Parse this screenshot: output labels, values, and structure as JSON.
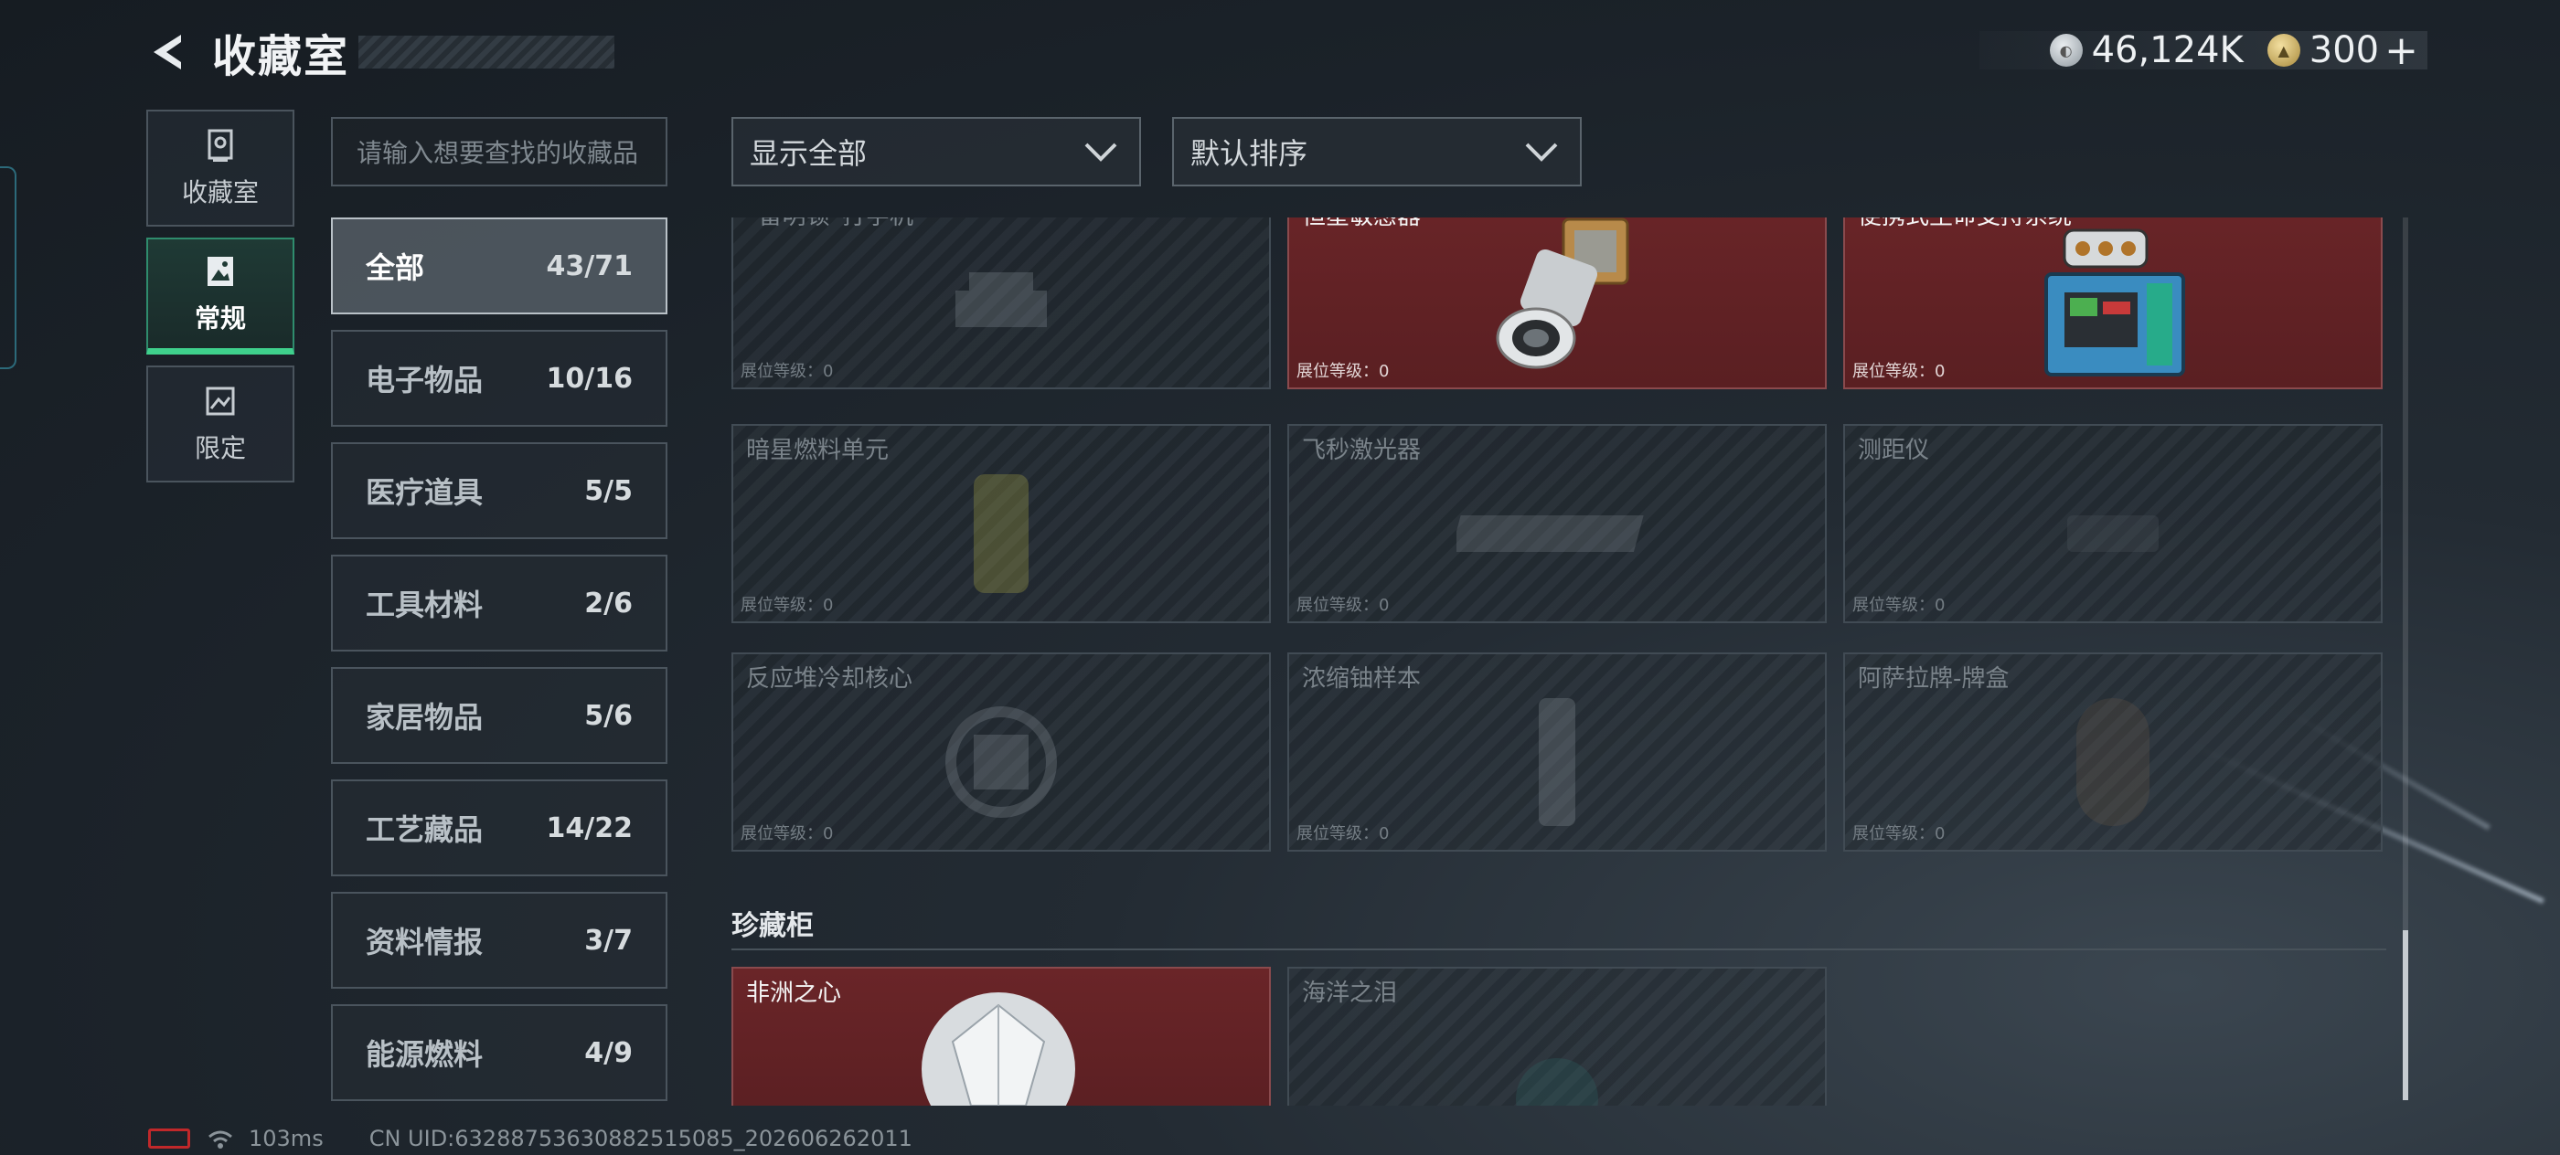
{
  "header": {
    "title": "收藏室",
    "silver_amount": "46,124K",
    "gold_amount": "300",
    "plus_label": "+"
  },
  "sidenav": {
    "items": [
      {
        "label": "收藏室",
        "icon": "trophy-case-icon",
        "active": false
      },
      {
        "label": "常规",
        "icon": "photo-frame-icon",
        "active": true
      },
      {
        "label": "限定",
        "icon": "picture-icon",
        "active": false
      }
    ]
  },
  "search": {
    "placeholder": "请输入想要查找的收藏品"
  },
  "categories": [
    {
      "name": "全部",
      "count": "43/71",
      "active": true
    },
    {
      "name": "电子物品",
      "count": "10/16"
    },
    {
      "name": "医疗道具",
      "count": "5/5"
    },
    {
      "name": "工具材料",
      "count": "2/6"
    },
    {
      "name": "家居物品",
      "count": "5/6"
    },
    {
      "name": "工艺藏品",
      "count": "14/22"
    },
    {
      "name": "资料情报",
      "count": "3/7"
    },
    {
      "name": "能源燃料",
      "count": "4/9"
    }
  ],
  "filters": {
    "show": "显示全部",
    "sort": "默认排序"
  },
  "items": [
    {
      "name": "“雷明顿”打字机",
      "level": "展位等级：0",
      "owned": false,
      "icon": "typewriter-icon"
    },
    {
      "name": "恒星敏感器",
      "level": "展位等级：0",
      "owned": true,
      "icon": "star-sensor-icon"
    },
    {
      "name": "便携式生命支持系统",
      "level": "展位等级：0",
      "owned": true,
      "icon": "life-support-icon"
    },
    {
      "name": "暗星燃料单元",
      "level": "展位等级：0",
      "owned": false,
      "icon": "fuel-cell-icon"
    },
    {
      "name": "飞秒激光器",
      "level": "展位等级：0",
      "owned": false,
      "icon": "laser-icon"
    },
    {
      "name": "测距仪",
      "level": "展位等级：0",
      "owned": false,
      "icon": "rangefinder-icon"
    },
    {
      "name": "反应堆冷却核心",
      "level": "展位等级：0",
      "owned": false,
      "icon": "reactor-core-icon"
    },
    {
      "name": "浓缩铀样本",
      "level": "展位等级：0",
      "owned": false,
      "icon": "uranium-sample-icon"
    },
    {
      "name": "阿萨拉牌-牌盒",
      "level": "展位等级：0",
      "owned": false,
      "icon": "card-box-icon"
    }
  ],
  "treasure_section": {
    "title": "珍藏柜",
    "items": [
      {
        "name": "非洲之心",
        "owned": true,
        "icon": "diamond-icon"
      },
      {
        "name": "海洋之泪",
        "owned": false,
        "icon": "gem-icon"
      }
    ]
  },
  "status_bar": {
    "ping": "103ms",
    "uid": "CN UID:632887536308825150​85_202606262011"
  },
  "colors": {
    "owned_card": "#6a2528",
    "active_nav_accent": "#3fd08c"
  }
}
